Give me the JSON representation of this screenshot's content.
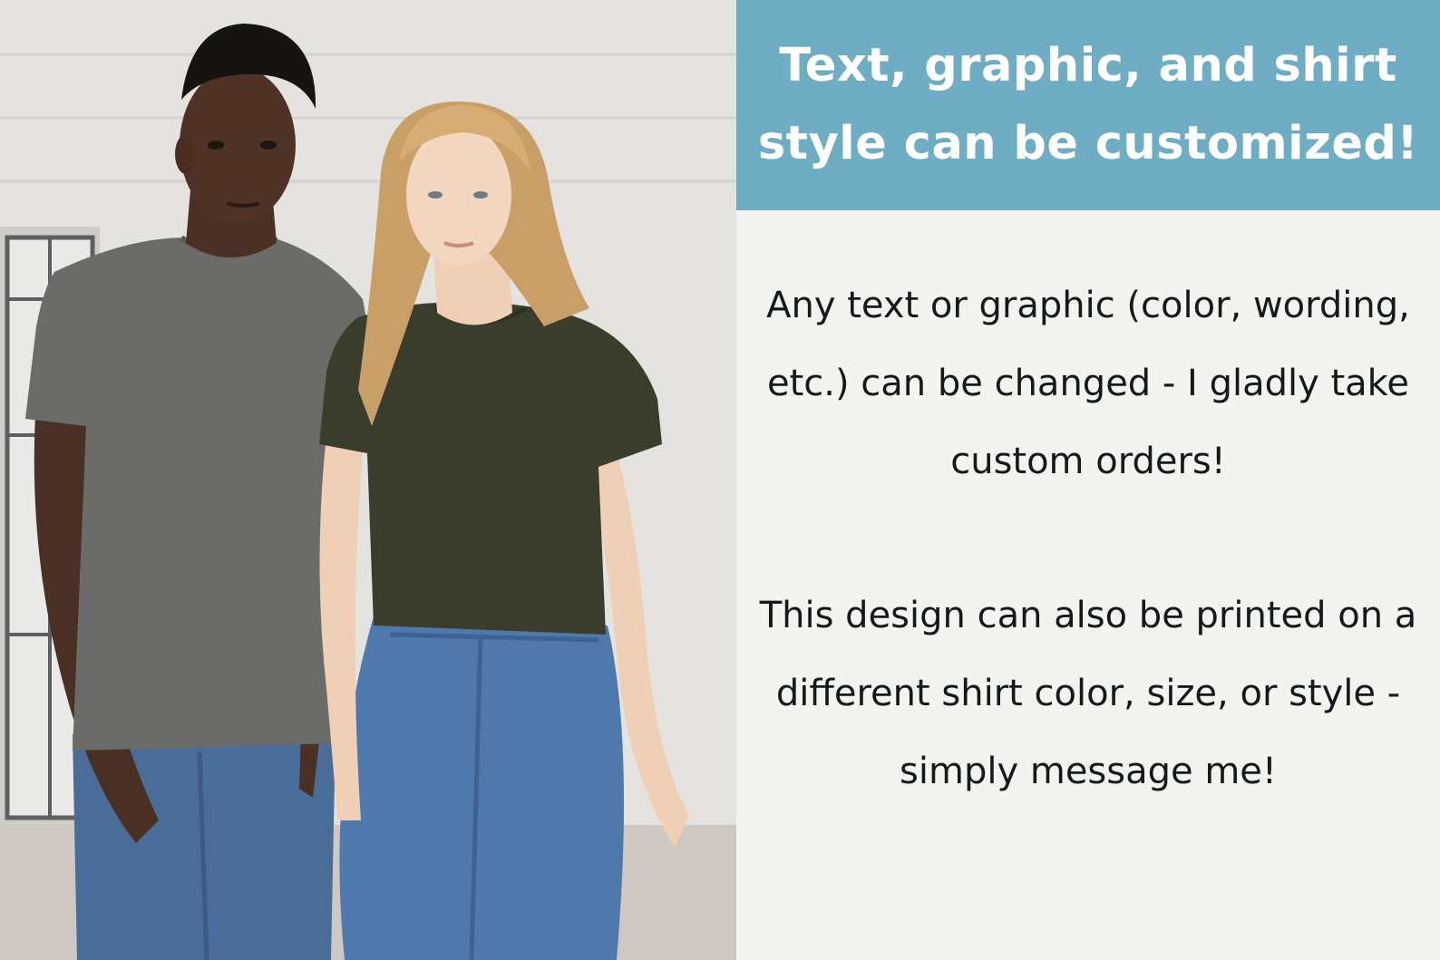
{
  "banner": {
    "title": "Text, graphic, and shirt style can be customized!",
    "background_color": "#6fadc4",
    "text_color": "#ffffff"
  },
  "body": {
    "paragraph_1": "Any text or graphic (color, wording, etc.) can be changed - I gladly take custom orders!",
    "paragraph_2": "This design can also be printed on a different shirt color, size, or style - simply message me!",
    "background_color": "#f3f3ef",
    "text_color": "#141a1c"
  },
  "photo": {
    "subject": "two models wearing plain t-shirts",
    "shirt_colors": [
      "#6b6b6a",
      "#3a3c2c"
    ],
    "jeans_color": "#4f74a6"
  }
}
